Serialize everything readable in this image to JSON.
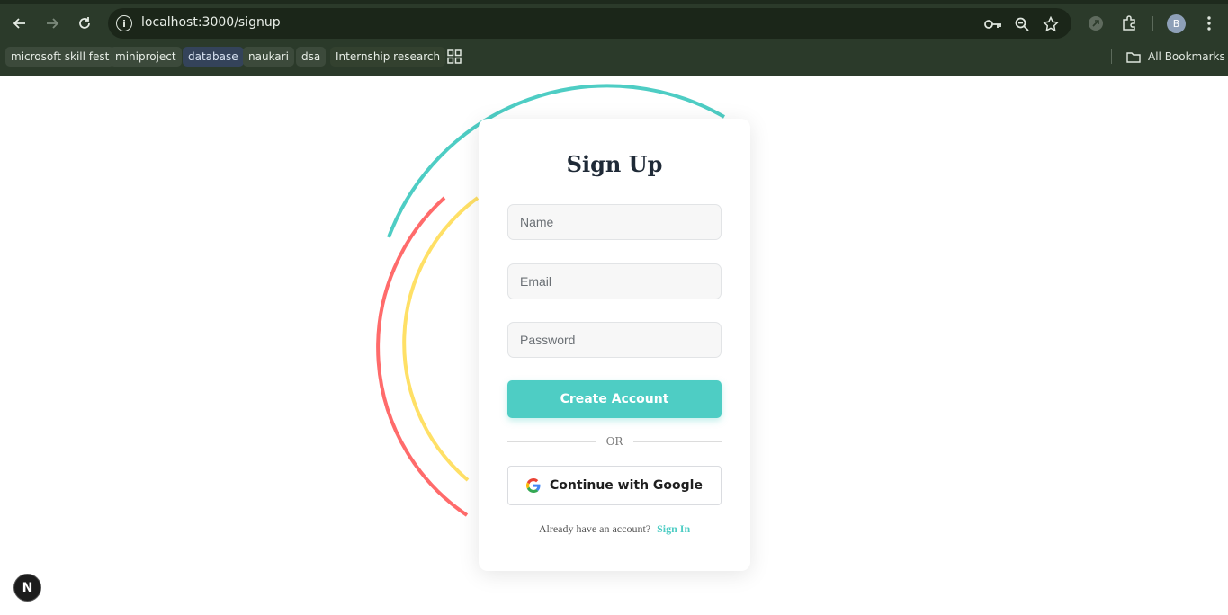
{
  "browser": {
    "url": "localhost:3000/signup",
    "profile_initial": "B",
    "bookmarks": [
      {
        "label": "microsoft skill fest"
      },
      {
        "label": "miniproject"
      },
      {
        "label": "database"
      },
      {
        "label": "naukari"
      },
      {
        "label": "dsa"
      },
      {
        "label": "Internship research"
      }
    ],
    "all_bookmarks_label": "All Bookmarks"
  },
  "signup": {
    "title": "Sign Up",
    "name_placeholder": "Name",
    "email_placeholder": "Email",
    "password_placeholder": "Password",
    "create_button": "Create Account",
    "divider_text": "OR",
    "google_button": "Continue with Google",
    "signin_prompt": "Already have an account?",
    "signin_link": "Sign In"
  },
  "colors": {
    "accent": "#4ecdc4",
    "arc_red": "#ff6b6b",
    "arc_yellow": "#ffe066"
  },
  "badge": {
    "label": "N"
  }
}
